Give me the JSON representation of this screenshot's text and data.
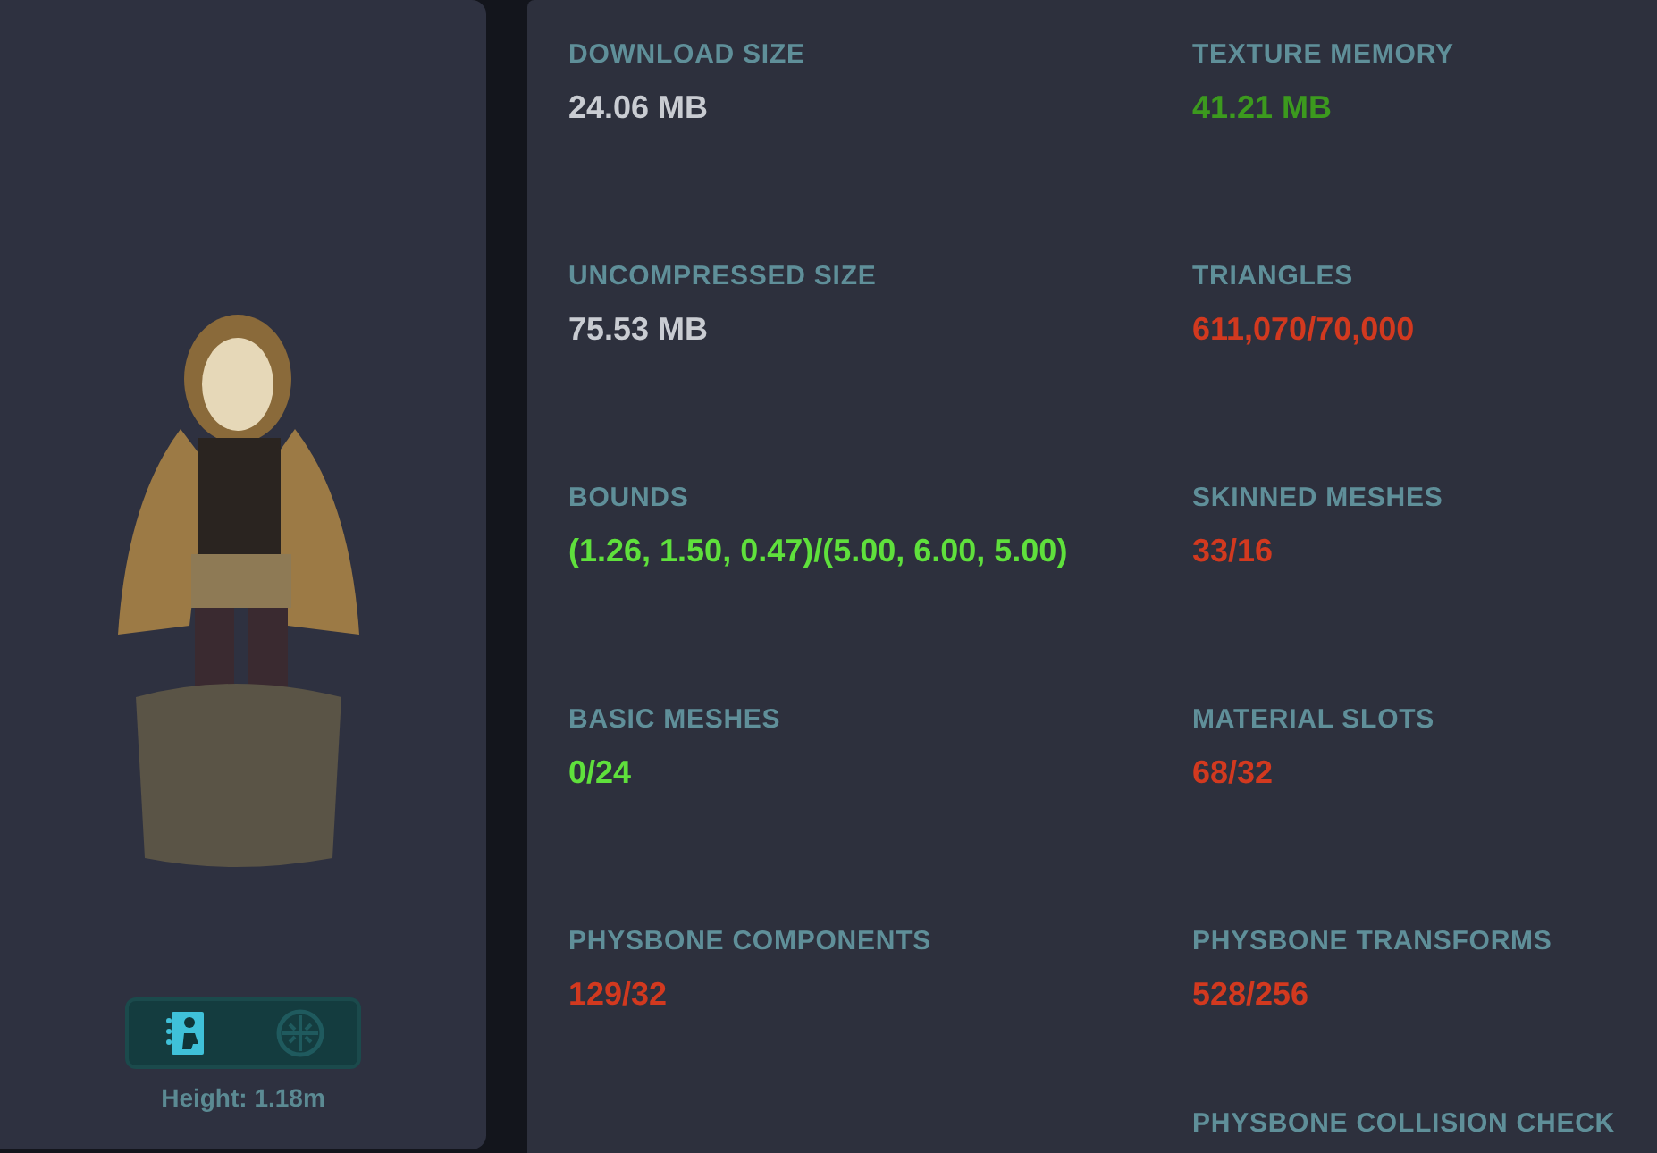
{
  "preview": {
    "view_toggles": [
      {
        "kind": "info",
        "selected": true
      },
      {
        "kind": "bones",
        "selected": false
      }
    ],
    "height_label": "Height: 1.18m"
  },
  "stats": [
    {
      "label": "DOWNLOAD SIZE",
      "value": "24.06 MB",
      "color": "#c9ccd2"
    },
    {
      "label": "TEXTURE MEMORY",
      "value": "41.21 MB",
      "color": "#3c9a1e"
    },
    {
      "label": "UNCOMPRESSED SIZE",
      "value": "75.53 MB",
      "color": "#c9ccd2"
    },
    {
      "label": "TRIANGLES",
      "value": "611,070/70,000",
      "color": "#d2391f"
    },
    {
      "label": "BOUNDS",
      "value": "(1.26, 1.50, 0.47)/(5.00, 6.00, 5.00)",
      "color": "#5fe03c"
    },
    {
      "label": "SKINNED MESHES",
      "value": "33/16",
      "color": "#d2391f"
    },
    {
      "label": "BASIC MESHES",
      "value": "0/24",
      "color": "#5fe03c"
    },
    {
      "label": "MATERIAL SLOTS",
      "value": "68/32",
      "color": "#d2391f"
    },
    {
      "label": "PHYSBONE COMPONENTS",
      "value": "129/32",
      "color": "#d2391f"
    },
    {
      "label": "PHYSBONE TRANSFORMS",
      "value": "528/256",
      "color": "#d2391f"
    },
    {
      "label": "PHYSBONE COLLISION CHECK"
    }
  ]
}
